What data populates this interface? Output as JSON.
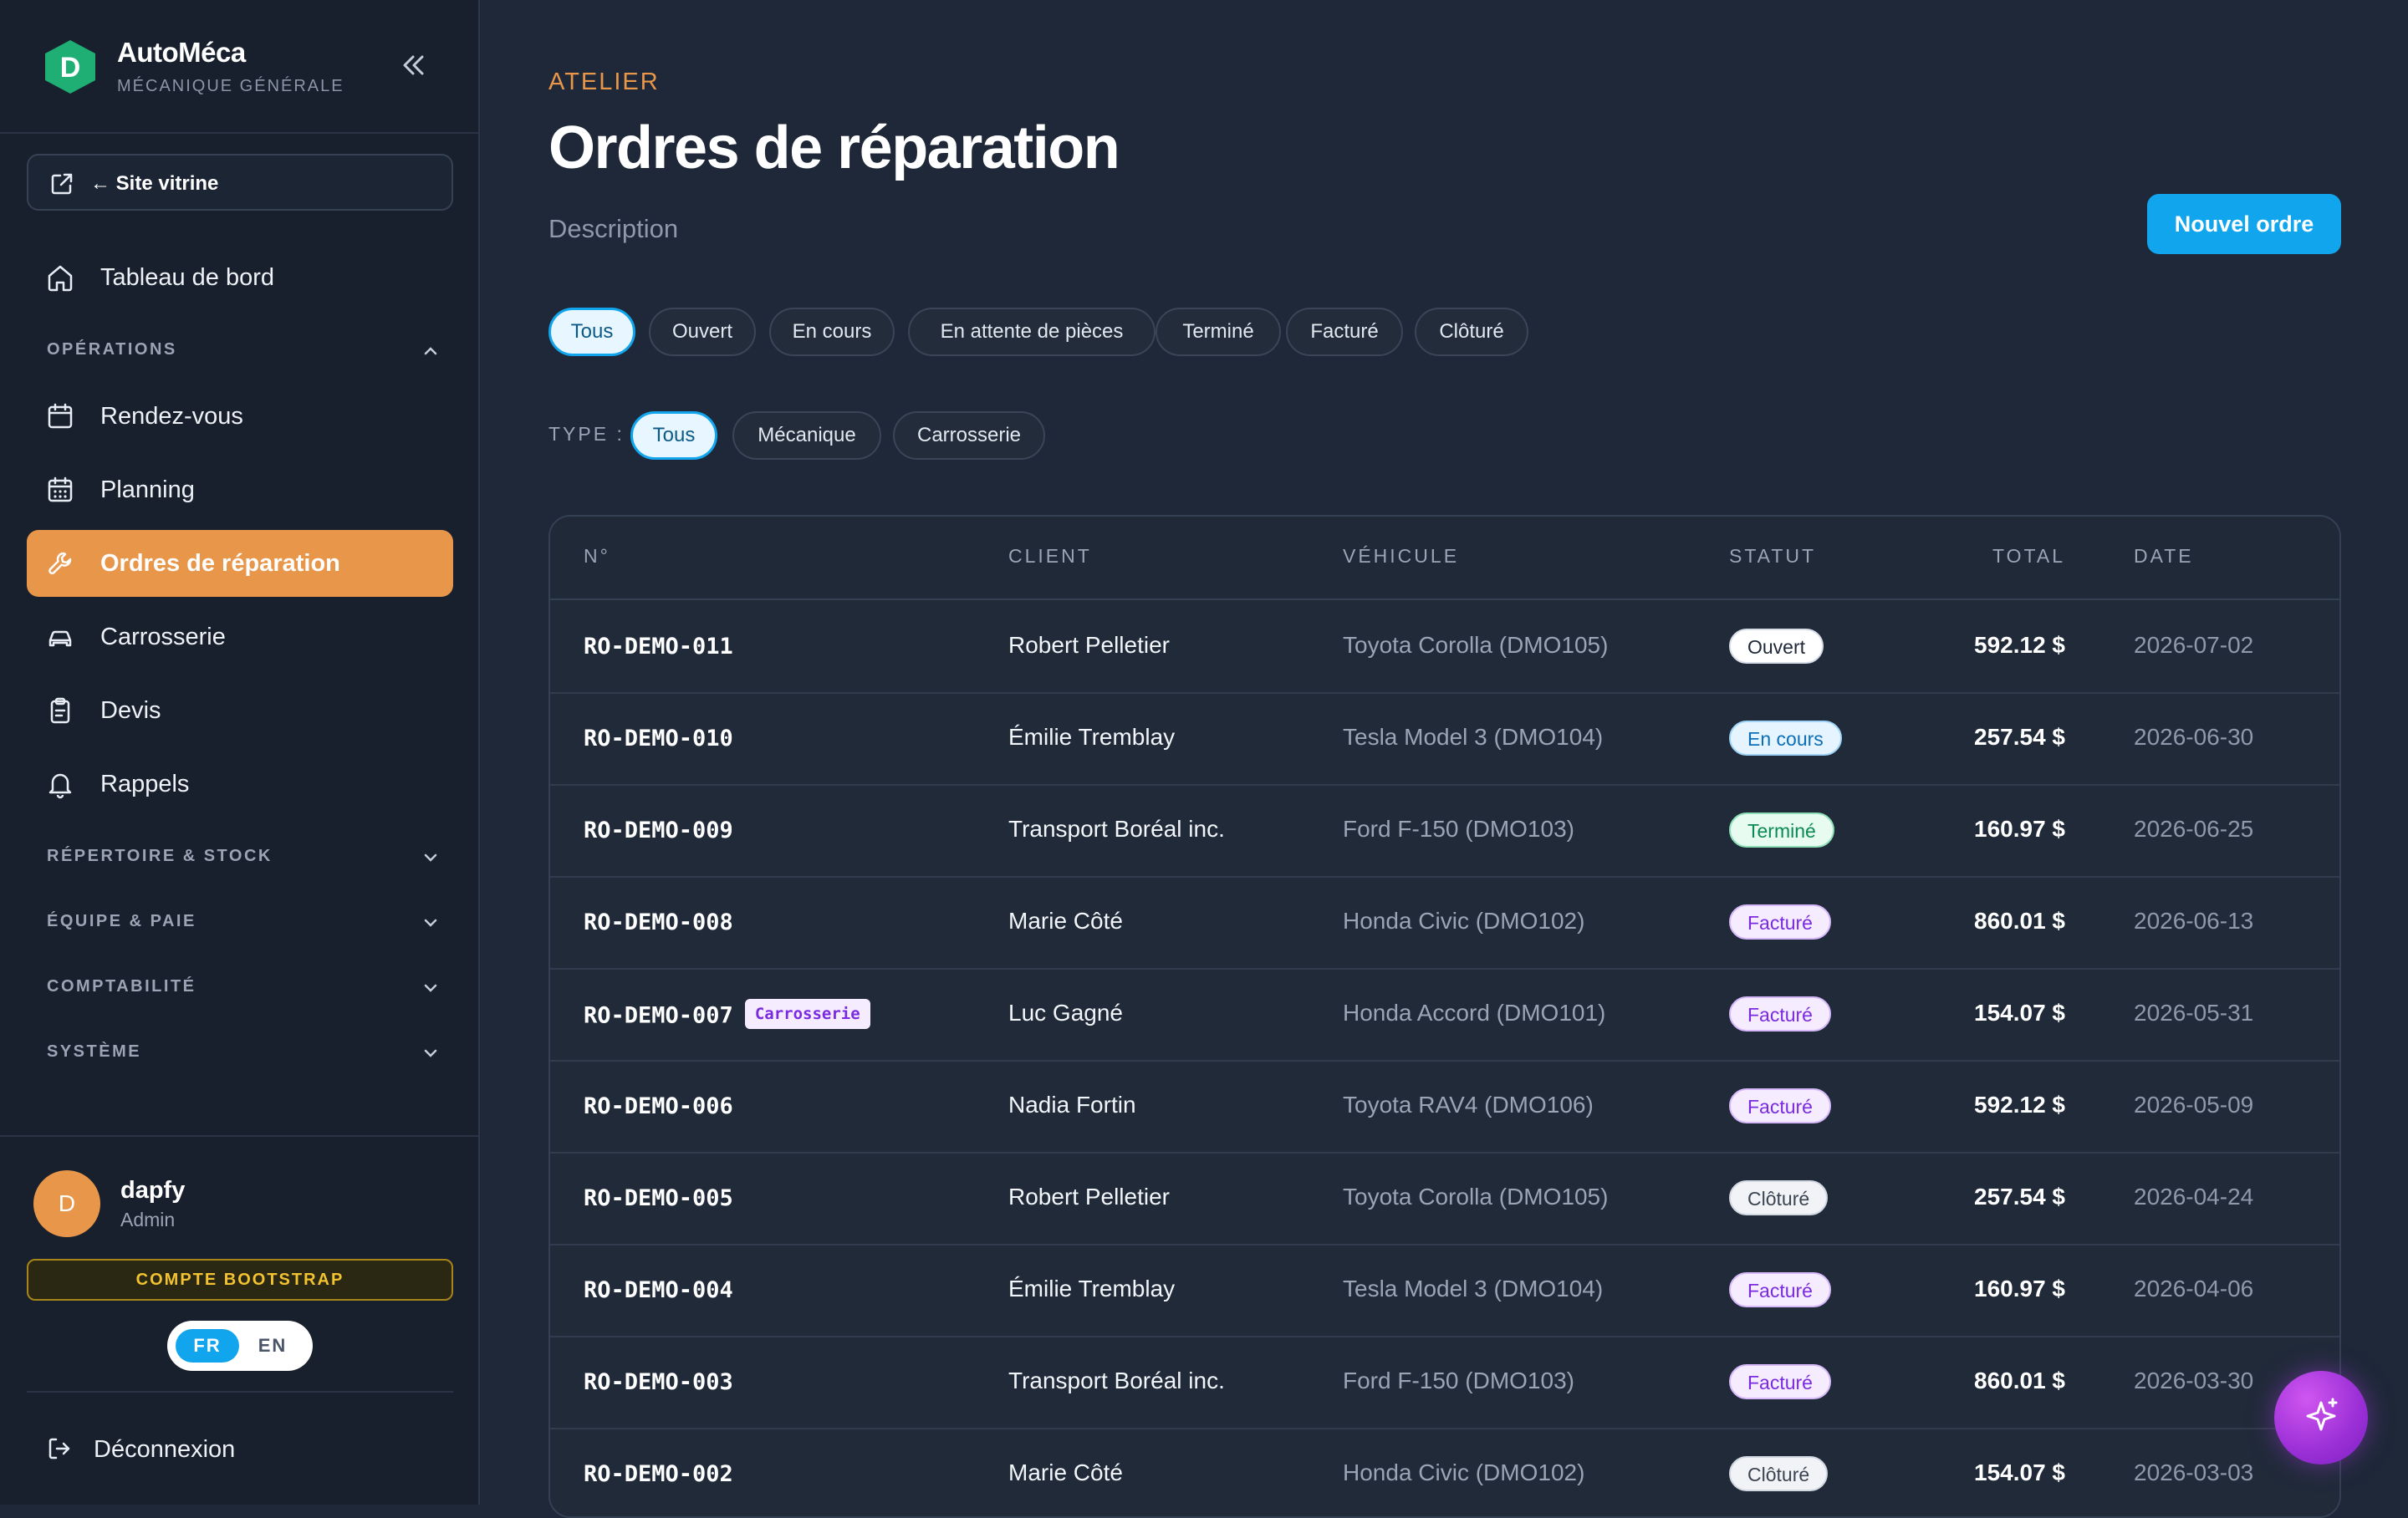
{
  "brand": {
    "name": "AutoMéca",
    "subtitle": "MÉCANIQUE GÉNÉRALE",
    "logo_letter": "D",
    "logo_color": "#1fae74"
  },
  "sidebar": {
    "site_link": "← Site vitrine",
    "dashboard": "Tableau de bord",
    "sections": {
      "operations": "OPÉRATIONS",
      "repertoire": "RÉPERTOIRE & STOCK",
      "equipe": "ÉQUIPE & PAIE",
      "comptabilite": "COMPTABILITÉ",
      "systeme": "SYSTÈME"
    },
    "items": [
      {
        "label": "Rendez-vous",
        "icon": "calendar-icon"
      },
      {
        "label": "Planning",
        "icon": "calendar-grid-icon"
      },
      {
        "label": "Ordres de réparation",
        "icon": "wrench-icon",
        "active": true
      },
      {
        "label": "Carrosserie",
        "icon": "car-icon"
      },
      {
        "label": "Devis",
        "icon": "clipboard-icon"
      },
      {
        "label": "Rappels",
        "icon": "bell-icon"
      }
    ],
    "active_color": "#e8964a"
  },
  "user": {
    "initial": "D",
    "name": "dapfy",
    "role": "Admin",
    "account_badge": "COMPTE BOOTSTRAP",
    "lang_fr": "FR",
    "lang_en": "EN",
    "lang_selected": "FR",
    "logout": "Déconnexion"
  },
  "header": {
    "eyebrow": "ATELIER",
    "title": "Ordres de réparation",
    "description": "Description",
    "new_button": "Nouvel ordre"
  },
  "status_filters": [
    "Tous",
    "Ouvert",
    "En cours",
    "En attente de pièces",
    "Terminé",
    "Facturé",
    "Clôturé"
  ],
  "status_filter_selected": "Tous",
  "type_filter": {
    "label": "TYPE :",
    "options": [
      "Tous",
      "Mécanique",
      "Carrosserie"
    ],
    "selected": "Tous"
  },
  "table": {
    "columns": {
      "num": "N°",
      "client": "CLIENT",
      "vehicle": "VÉHICULE",
      "status": "STATUT",
      "total": "TOTAL",
      "date": "DATE"
    },
    "rows": [
      {
        "num": "RO-DEMO-011",
        "tag": "",
        "client": "Robert Pelletier",
        "vehicle": "Toyota Corolla (DMO105)",
        "status": "Ouvert",
        "total": "592.12 $",
        "date": "2026-07-02"
      },
      {
        "num": "RO-DEMO-010",
        "tag": "",
        "client": "Émilie Tremblay",
        "vehicle": "Tesla Model 3 (DMO104)",
        "status": "En cours",
        "total": "257.54 $",
        "date": "2026-06-30"
      },
      {
        "num": "RO-DEMO-009",
        "tag": "",
        "client": "Transport Boréal inc.",
        "vehicle": "Ford F-150 (DMO103)",
        "status": "Terminé",
        "total": "160.97 $",
        "date": "2026-06-25"
      },
      {
        "num": "RO-DEMO-008",
        "tag": "",
        "client": "Marie Côté",
        "vehicle": "Honda Civic (DMO102)",
        "status": "Facturé",
        "total": "860.01 $",
        "date": "2026-06-13"
      },
      {
        "num": "RO-DEMO-007",
        "tag": "Carrosserie",
        "client": "Luc Gagné",
        "vehicle": "Honda Accord (DMO101)",
        "status": "Facturé",
        "total": "154.07 $",
        "date": "2026-05-31"
      },
      {
        "num": "RO-DEMO-006",
        "tag": "",
        "client": "Nadia Fortin",
        "vehicle": "Toyota RAV4 (DMO106)",
        "status": "Facturé",
        "total": "592.12 $",
        "date": "2026-05-09"
      },
      {
        "num": "RO-DEMO-005",
        "tag": "",
        "client": "Robert Pelletier",
        "vehicle": "Toyota Corolla (DMO105)",
        "status": "Clôturé",
        "total": "257.54 $",
        "date": "2026-04-24"
      },
      {
        "num": "RO-DEMO-004",
        "tag": "",
        "client": "Émilie Tremblay",
        "vehicle": "Tesla Model 3 (DMO104)",
        "status": "Facturé",
        "total": "160.97 $",
        "date": "2026-04-06"
      },
      {
        "num": "RO-DEMO-003",
        "tag": "",
        "client": "Transport Boréal inc.",
        "vehicle": "Ford F-150 (DMO103)",
        "status": "Facturé",
        "total": "860.01 $",
        "date": "2026-03-30"
      },
      {
        "num": "RO-DEMO-002",
        "tag": "",
        "client": "Marie Côté",
        "vehicle": "Honda Civic (DMO102)",
        "status": "Clôturé",
        "total": "154.07 $",
        "date": "2026-03-03"
      }
    ]
  },
  "fab": {
    "icon": "sparkles-icon"
  }
}
